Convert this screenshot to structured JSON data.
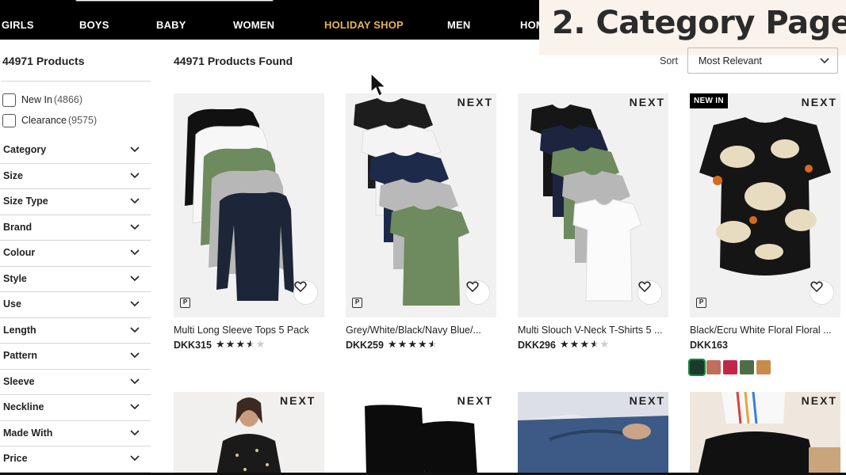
{
  "nav": {
    "items": [
      "GIRLS",
      "BOYS",
      "BABY",
      "WOMEN",
      "HOLIDAY SHOP",
      "MEN",
      "HOM"
    ],
    "highlight_color": "#e3b45a"
  },
  "overlay": {
    "title": "2. Category Page"
  },
  "sidebar": {
    "product_count": "44971 Products",
    "checkboxes": [
      {
        "label": "New In",
        "count": "(4866)"
      },
      {
        "label": "Clearance",
        "count": "(9575)"
      }
    ],
    "facets": [
      "Category",
      "Size",
      "Size Type",
      "Brand",
      "Colour",
      "Style",
      "Use",
      "Length",
      "Pattern",
      "Sleeve",
      "Neckline",
      "Made With",
      "Price"
    ]
  },
  "main": {
    "found": "44971 Products Found",
    "sort_label": "Sort",
    "sort_value": "Most Relevant"
  },
  "products": [
    {
      "name": "Multi Long Sleeve Tops 5 Pack",
      "price": "DKK315",
      "rating": 3.5,
      "brand": "",
      "badge": ""
    },
    {
      "name": "Grey/White/Black/Navy Blue/...",
      "price": "DKK259",
      "rating": 4.5,
      "brand": "NEXT",
      "badge": ""
    },
    {
      "name": "Multi Slouch V-Neck T-Shirts 5 ...",
      "price": "DKK296",
      "rating": 3.5,
      "brand": "NEXT",
      "badge": ""
    },
    {
      "name": "Black/Ecru White Floral Floral ...",
      "price": "DKK163",
      "rating": null,
      "brand": "NEXT",
      "badge": "NEW IN",
      "swatches": [
        "#1b3a2a",
        "#c0705a",
        "#c2264a",
        "#4f6e48",
        "#c98b4a"
      ]
    }
  ],
  "products_row2": [
    {
      "brand": "NEXT"
    },
    {
      "brand": "NEXT"
    },
    {
      "brand": "NEXT"
    },
    {
      "brand": "NEXT"
    }
  ],
  "icons": {
    "heart": "heart-icon",
    "chevron": "chevron-down-icon",
    "pay": "pay-icon",
    "cursor": "mouse-cursor-icon"
  }
}
